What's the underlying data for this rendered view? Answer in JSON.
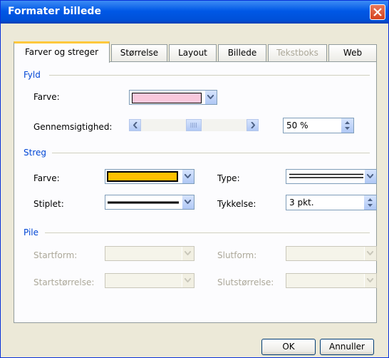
{
  "window": {
    "title": "Formater billede",
    "close_label": "Close"
  },
  "tabs": [
    {
      "label": "Farver og streger",
      "active": true
    },
    {
      "label": "Størrelse"
    },
    {
      "label": "Layout"
    },
    {
      "label": "Billede"
    },
    {
      "label": "Tekstboks",
      "disabled": true
    },
    {
      "label": "Web"
    }
  ],
  "fill": {
    "section_title": "Fyld",
    "color_label": "Farve:",
    "color_value": "#f9c8dc",
    "transparency_label": "Gennemsigtighed:",
    "transparency_percent": 50,
    "transparency_text": "50 %"
  },
  "line": {
    "section_title": "Streg",
    "color_label": "Farve:",
    "color_value": "#ffc000",
    "type_label": "Type:",
    "dash_label": "Stiplet:",
    "weight_label": "Tykkelse:",
    "weight_value": "3 pkt."
  },
  "arrows": {
    "section_title": "Pile",
    "begin_style_label": "Startform:",
    "begin_size_label": "Startstørrelse:",
    "end_style_label": "Slutform:",
    "end_size_label": "Slutstørrelse:"
  },
  "buttons": {
    "ok": "OK",
    "cancel": "Annuller"
  },
  "colors": {
    "accent": "#0046d5",
    "title_bar": "#0058e6"
  }
}
